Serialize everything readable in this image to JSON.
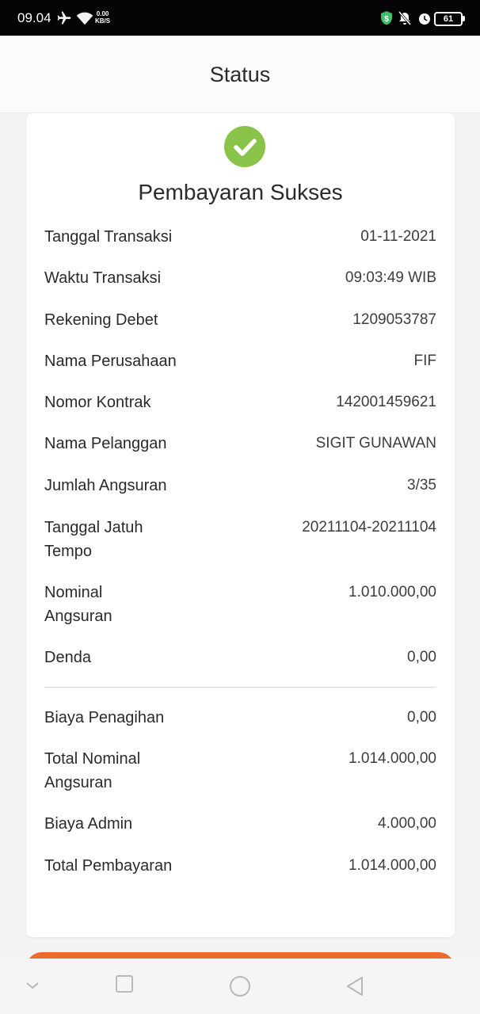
{
  "status_bar": {
    "time": "09.04",
    "net_speed_value": "0.00",
    "net_speed_unit": "KB/S",
    "battery": "61",
    "icons": [
      "airplane-icon",
      "wifi-icon",
      "shield-icon",
      "mute-vibrate-icon",
      "alarm-icon",
      "battery-icon"
    ]
  },
  "header": {
    "title": "Status"
  },
  "receipt": {
    "title": "Pembayaran Sukses",
    "status_icon": "check-circle-icon",
    "accent_color": "#8ac34a",
    "rows": [
      {
        "label": "Tanggal Transaksi",
        "value": "01-11-2021"
      },
      {
        "label": "Waktu Transaksi",
        "value": "09:03:49 WIB"
      },
      {
        "label": "Rekening Debet",
        "value": "1209053787"
      },
      {
        "label": "Nama Perusahaan",
        "value": "FIF"
      },
      {
        "label": "Nomor Kontrak",
        "value": "142001459621"
      },
      {
        "label": "Nama Pelanggan",
        "value": "SIGIT GUNAWAN"
      },
      {
        "label": "Jumlah Angsuran",
        "value": "3/35"
      },
      {
        "label": "Tanggal Jatuh Tempo",
        "value": "20211104-20211104"
      },
      {
        "label": "Nominal Angsuran",
        "value": "1.010.000,00"
      },
      {
        "label": "Denda",
        "value": "0,00"
      }
    ],
    "summary_rows": [
      {
        "label": "Biaya Penagihan",
        "value": "0,00"
      },
      {
        "label": "Total Nominal Angsuran",
        "value": "1.014.000,00"
      },
      {
        "label": "Biaya Admin",
        "value": "4.000,00"
      },
      {
        "label": "Total Pembayaran",
        "value": "1.014.000,00"
      }
    ]
  },
  "action_button": {
    "color": "#ef6a2d"
  },
  "nav_bar": {
    "icons": [
      "nav-collapse-icon",
      "recent-apps-icon",
      "home-icon",
      "back-icon"
    ]
  }
}
